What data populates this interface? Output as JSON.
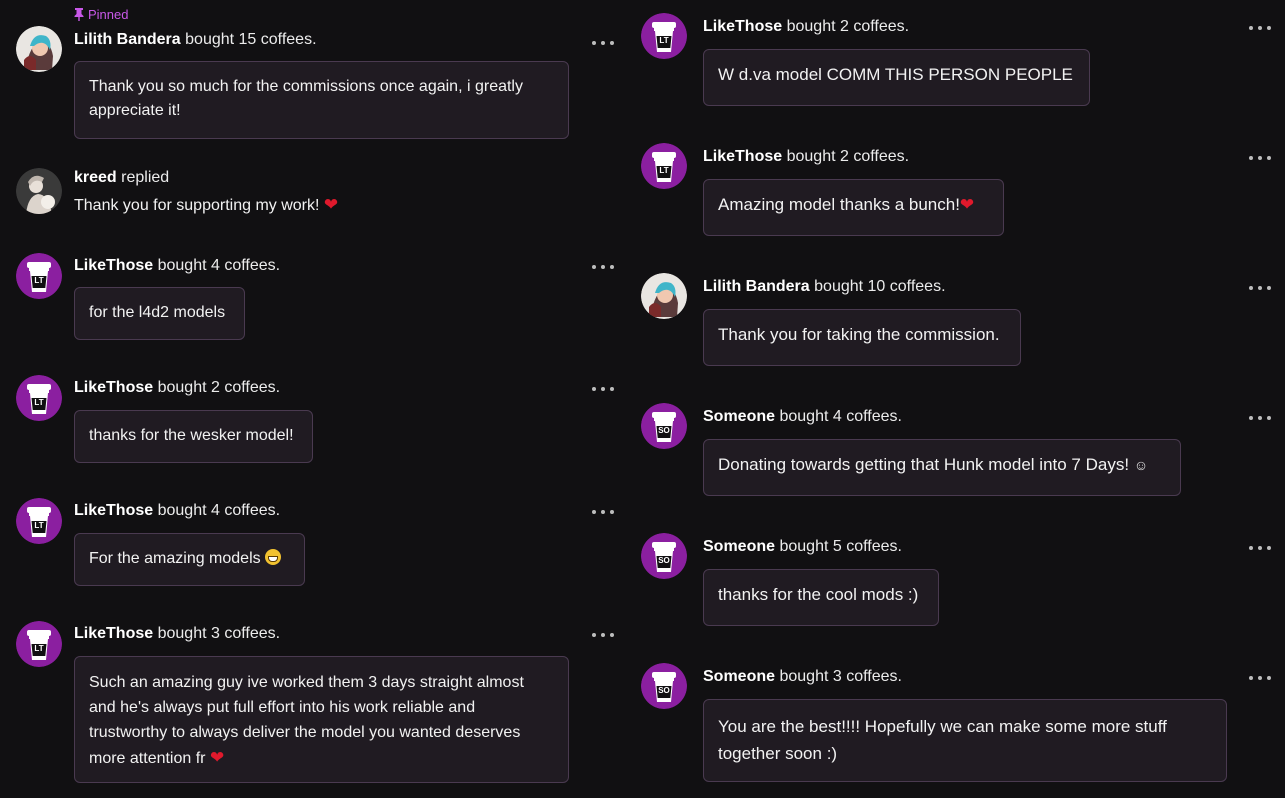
{
  "colors": {
    "background": "#111012",
    "bubble": "#201b22",
    "bubble_border": "#4a3a50",
    "accent": "#c858e8",
    "avatar_purple": "#8b1fa0",
    "heart": "#e0192c"
  },
  "left": {
    "pinned_label": "Pinned",
    "items": [
      {
        "avatar": "lilith-avatar",
        "name": "Lilith Bandera",
        "action": "bought 15 coffees.",
        "message": "Thank you so much for the commissions once again, i greatly appreciate it!"
      },
      {
        "avatar": "kreed-avatar",
        "name": "kreed",
        "action": "replied",
        "message": "Thank you for supporting my work!",
        "icon": "heart-icon"
      },
      {
        "avatar": "LT",
        "name": "LikeThose",
        "action": "bought 4 coffees.",
        "message": "for the l4d2 models"
      },
      {
        "avatar": "LT",
        "name": "LikeThose",
        "action": "bought 2 coffees.",
        "message": "thanks for the wesker model!"
      },
      {
        "avatar": "LT",
        "name": "LikeThose",
        "action": "bought 4 coffees.",
        "message": "For the amazing models",
        "icon": "grin-emoji-icon"
      },
      {
        "avatar": "LT",
        "name": "LikeThose",
        "action": "bought 3 coffees.",
        "message": "Such an amazing guy ive worked them 3 days straight almost and he's always put full effort into his work reliable and trustworthy to always deliver the model you wanted deserves more attention fr",
        "icon": "heart-icon"
      }
    ]
  },
  "right": {
    "items": [
      {
        "avatar": "LT",
        "name": "LikeThose",
        "action": "bought 2 coffees.",
        "message": "W d.va model COMM THIS PERSON PEOPLE"
      },
      {
        "avatar": "LT",
        "name": "LikeThose",
        "action": "bought 2 coffees.",
        "message": "Amazing model thanks a bunch!",
        "icon": "heart-icon"
      },
      {
        "avatar": "lilith-avatar",
        "name": "Lilith Bandera",
        "action": "bought 10 coffees.",
        "message": "Thank you for taking the commission."
      },
      {
        "avatar": "SO",
        "name": "Someone",
        "action": "bought 4 coffees.",
        "message": "Donating towards getting that Hunk model into 7 Days!",
        "icon": "smile-emoji-icon"
      },
      {
        "avatar": "SO",
        "name": "Someone",
        "action": "bought 5 coffees.",
        "message": "thanks for the cool mods :)"
      },
      {
        "avatar": "SO",
        "name": "Someone",
        "action": "bought 3 coffees.",
        "message": "You are the best!!!! Hopefully we can make some more stuff together soon :)"
      }
    ]
  }
}
